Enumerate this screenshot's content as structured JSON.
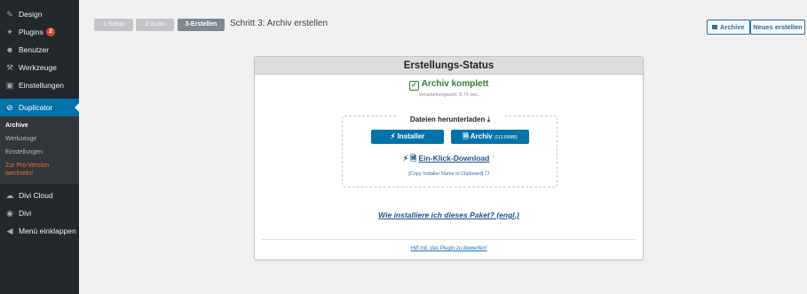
{
  "sidebar": {
    "items_top": [
      {
        "label": "Design",
        "icon": "paint-brush-icon"
      },
      {
        "label": "Plugins",
        "icon": "plugin-icon",
        "badge": "2"
      },
      {
        "label": "Benutzer",
        "icon": "users-icon"
      },
      {
        "label": "Werkzeuge",
        "icon": "wrench-icon"
      },
      {
        "label": "Einstellungen",
        "icon": "settings-icon"
      }
    ],
    "active": {
      "label": "Duplicator",
      "icon": "duplicator-icon"
    },
    "submenu": [
      {
        "label": "Archive",
        "state": "current"
      },
      {
        "label": "Werkzeuge",
        "state": "normal"
      },
      {
        "label": "Einstellungen",
        "state": "normal"
      },
      {
        "label": "Zur Pro-Version wechseln!",
        "state": "pro"
      }
    ],
    "items_bottom": [
      {
        "label": "Divi Cloud",
        "icon": "cloud-icon"
      },
      {
        "label": "Divi",
        "icon": "divi-icon"
      },
      {
        "label": "Menü einklappen",
        "icon": "collapse-icon"
      }
    ]
  },
  "steps": {
    "step1": "1-Setup",
    "step2": "2-Scan",
    "step3": "3-Erstellen",
    "title": "Schritt 3: Archiv erstellen"
  },
  "header_buttons": {
    "archive": "Archive",
    "new": "Neues erstellen"
  },
  "panel": {
    "title": "Erstellungs-Status",
    "status": "Archiv komplett",
    "processing_time": "Verarbeitungszeit: 8.74 sec.",
    "download_title": "Dateien herunterladen",
    "installer_btn": "Installer",
    "archive_btn": "Archiv",
    "archive_size": "(113.69MB)",
    "one_click": "Ein-Klick-Download",
    "copy_link": "[Copy Installer Name to Clipboard]",
    "howto_link": "Wie installiere ich dieses Paket? (engl.)",
    "rate_link": "Hilf mit, das Plugin zu bewerten!"
  },
  "colors": {
    "sidebar_bg": "#23282d",
    "active_bg": "#0073aa",
    "button_blue": "#0073aa",
    "success_green": "#2e7d32",
    "pro_orange": "#f56e28"
  }
}
